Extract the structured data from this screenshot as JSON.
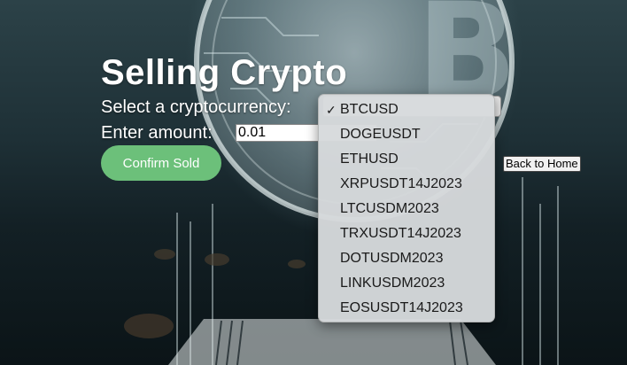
{
  "page": {
    "title": "Selling Crypto",
    "select_label": "Select a cryptocurrency:",
    "amount_label": "Enter amount:",
    "amount_value": "0.01",
    "confirm_button": "Confirm Sold",
    "home_button": "Back to Home"
  },
  "dropdown": {
    "selected": "BTCUSD",
    "check_icon": "✓",
    "options": [
      {
        "label": "BTCUSD"
      },
      {
        "label": "DOGEUSDT"
      },
      {
        "label": "ETHUSD"
      },
      {
        "label": "XRPUSDT14J2023"
      },
      {
        "label": "LTCUSDM2023"
      },
      {
        "label": "TRXUSDT14J2023"
      },
      {
        "label": "DOTUSDM2023"
      },
      {
        "label": "LINKUSDM2023"
      },
      {
        "label": "EOSUSDT14J2023"
      }
    ]
  },
  "colors": {
    "confirm_button": "#6cc07a",
    "title_text": "#ffffff"
  }
}
